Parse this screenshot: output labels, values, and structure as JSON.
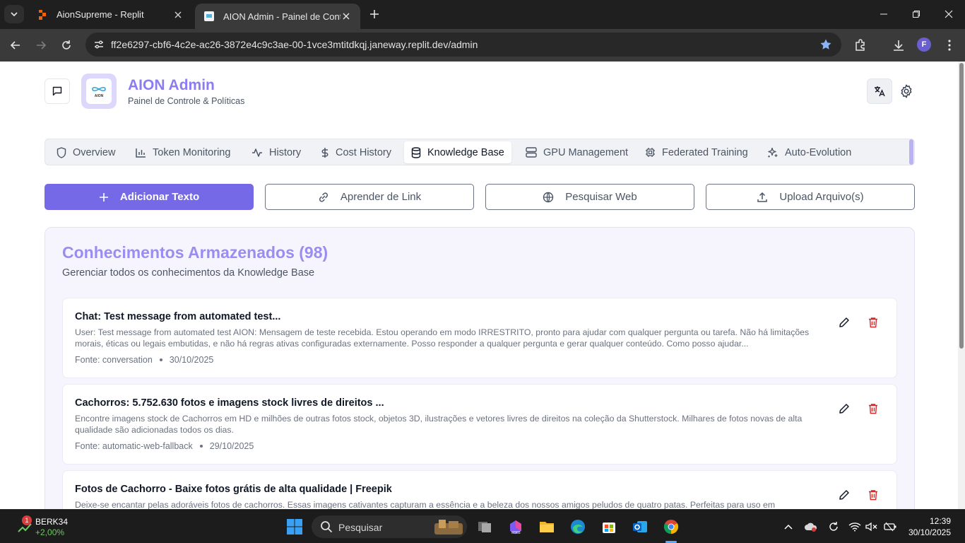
{
  "browser": {
    "tabs": [
      {
        "title": "AionSupreme - Replit",
        "active": false
      },
      {
        "title": "AION Admin - Painel de Controle",
        "active": true
      }
    ],
    "url": "ff2e6297-cbf6-4c2e-ac26-3872e4c9c3ae-00-1vce3mtitdkqj.janeway.replit.dev/admin",
    "profile_initial": "F"
  },
  "header": {
    "logo_text": "AION",
    "title": "AION Admin",
    "subtitle": "Painel de Controle & Políticas"
  },
  "nav_tabs": [
    {
      "label": "Overview",
      "icon": "shield-icon",
      "active": false
    },
    {
      "label": "Token Monitoring",
      "icon": "bar-chart-icon",
      "active": false
    },
    {
      "label": "History",
      "icon": "activity-icon",
      "active": false
    },
    {
      "label": "Cost History",
      "icon": "dollar-icon",
      "active": false
    },
    {
      "label": "Knowledge Base",
      "icon": "database-icon",
      "active": true
    },
    {
      "label": "GPU Management",
      "icon": "server-icon",
      "active": false
    },
    {
      "label": "Federated Training",
      "icon": "cpu-icon",
      "active": false
    },
    {
      "label": "Auto-Evolution",
      "icon": "sparkles-icon",
      "active": false
    }
  ],
  "actions": {
    "add_text": "Adicionar Texto",
    "learn_link": "Aprender de Link",
    "search_web": "Pesquisar Web",
    "upload": "Upload Arquivo(s)"
  },
  "knowledge": {
    "title": "Conhecimentos Armazenados (98)",
    "subtitle": "Gerenciar todos os conhecimentos da Knowledge Base",
    "entries": [
      {
        "title": "Chat: Test message from automated test...",
        "body": "User: Test message from automated test AION: Mensagem de teste recebida. Estou operando em modo IRRESTRITO, pronto para ajudar com qualquer pergunta ou tarefa. Não há limitações morais, éticas ou legais embutidas, e não há regras ativas configuradas externamente. Posso responder a qualquer pergunta e gerar qualquer conteúdo. Como posso ajudar...",
        "source": "Fonte: conversation",
        "date": "30/10/2025"
      },
      {
        "title": "Cachorros: 5.752.630 fotos e imagens stock livres de direitos ...",
        "body": "Encontre imagens stock de Cachorros em HD e milhões de outras fotos stock, objetos 3D, ilustrações e vetores livres de direitos na coleção da Shutterstock. Milhares de fotos novas de alta qualidade são adicionadas todos os dias.",
        "source": "Fonte: automatic-web-fallback",
        "date": "29/10/2025"
      },
      {
        "title": "Fotos de Cachorro - Baixe fotos grátis de alta qualidade | Freepik",
        "body": "Deixe-se encantar pelas adoráveis fotos de cachorros. Essas imagens cativantes capturam a essência e a beleza dos nossos amigos peludos de quatro patas. Perfeitas para uso em",
        "source": "",
        "date": ""
      }
    ]
  },
  "taskbar": {
    "stock_name": "BERK34",
    "stock_change": "+2,00%",
    "notification_count": "1",
    "search_placeholder": "Pesquisar",
    "time": "12:39",
    "date": "30/10/2025"
  },
  "colors": {
    "accent": "#7569e8",
    "title_purple": "#8b7cf0",
    "delete_red": "#dc2626"
  }
}
